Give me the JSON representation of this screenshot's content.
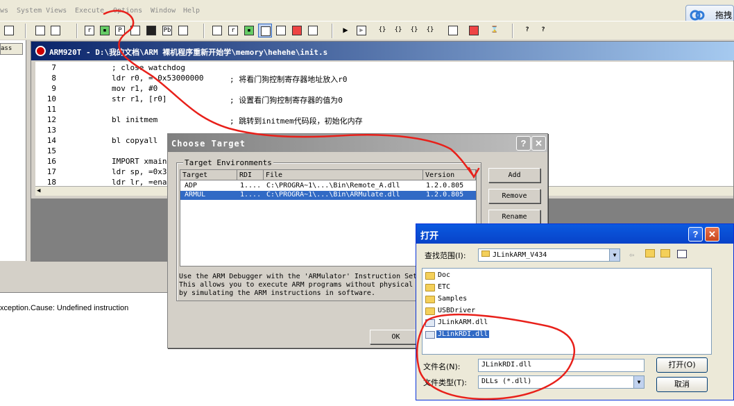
{
  "menu": [
    "ws",
    "System Views",
    "Execute",
    "Options",
    "Window",
    "Help"
  ],
  "drag_label": "拖拽",
  "left_tab": "ass",
  "editor": {
    "title": "ARM920T - D:\\我的文档\\ARM 裸机程序重新开始学\\memory\\hehehe\\init.s",
    "lines": [
      {
        "n": "7",
        "code": "; close watchdog",
        "comment": ""
      },
      {
        "n": "8",
        "code": "ldr r0, = 0x53000000",
        "comment": "; 将看门狗控制寄存器地址放入r0"
      },
      {
        "n": "9",
        "code": "mov r1, #0",
        "comment": ""
      },
      {
        "n": "10",
        "code": "str r1, [r0]",
        "comment": "; 设置看门狗控制寄存器的值为0"
      },
      {
        "n": "11",
        "code": "",
        "comment": ""
      },
      {
        "n": "12",
        "code": "bl initmem",
        "comment": "; 跳转到initmem代码段，初始化内存"
      },
      {
        "n": "13",
        "code": "",
        "comment": ""
      },
      {
        "n": "14",
        "code": "bl copyall",
        "comment": ""
      },
      {
        "n": "15",
        "code": "",
        "comment": ""
      },
      {
        "n": "16",
        "code": "IMPORT xmain",
        "comment": ""
      },
      {
        "n": "17",
        "code": "ldr sp, =0x3",
        "comment": ""
      },
      {
        "n": "18",
        "code": "ldr lr, =ena",
        "comment": ""
      }
    ]
  },
  "log_text": "xception.Cause: Undefined instruction",
  "choose_target": {
    "title": "Choose Target",
    "group_label": "Target Environments",
    "columns": [
      "Target",
      "RDI",
      "File",
      "Version"
    ],
    "rows": [
      {
        "target": "ADP",
        "rdi": "1....",
        "file": "C:\\PROGRA~1\\...\\Bin\\Remote_A.dll",
        "version": "1.2.0.805"
      },
      {
        "target": "ARMUL",
        "rdi": "1....",
        "file": "C:\\PROGRA~1\\...\\Bin\\ARMulate.dll",
        "version": "1.2.0.805"
      }
    ],
    "buttons": {
      "add": "Add",
      "remove": "Remove",
      "rename": "Rename",
      "ok": "OK"
    },
    "description": "Use the ARM Debugger with the 'ARMulator' Instruction Set\nThis allows you to execute ARM programs without physical\nby simulating the ARM instructions in software."
  },
  "open_dialog": {
    "title": "打开",
    "look_in_label": "查找范围(I):",
    "look_in_value": "JLinkARM_V434",
    "files": [
      {
        "name": "Doc",
        "type": "folder"
      },
      {
        "name": "ETC",
        "type": "folder"
      },
      {
        "name": "Samples",
        "type": "folder"
      },
      {
        "name": "USBDriver",
        "type": "folder"
      },
      {
        "name": "JLinkARM.dll",
        "type": "dll"
      },
      {
        "name": "JLinkRDI.dll",
        "type": "dll"
      }
    ],
    "filename_label": "文件名(N):",
    "filename_value": "JLinkRDI.dll",
    "filetype_label": "文件类型(T):",
    "filetype_value": "DLLs (*.dll)",
    "open_button": "打开(O)",
    "cancel_button": "取消"
  }
}
